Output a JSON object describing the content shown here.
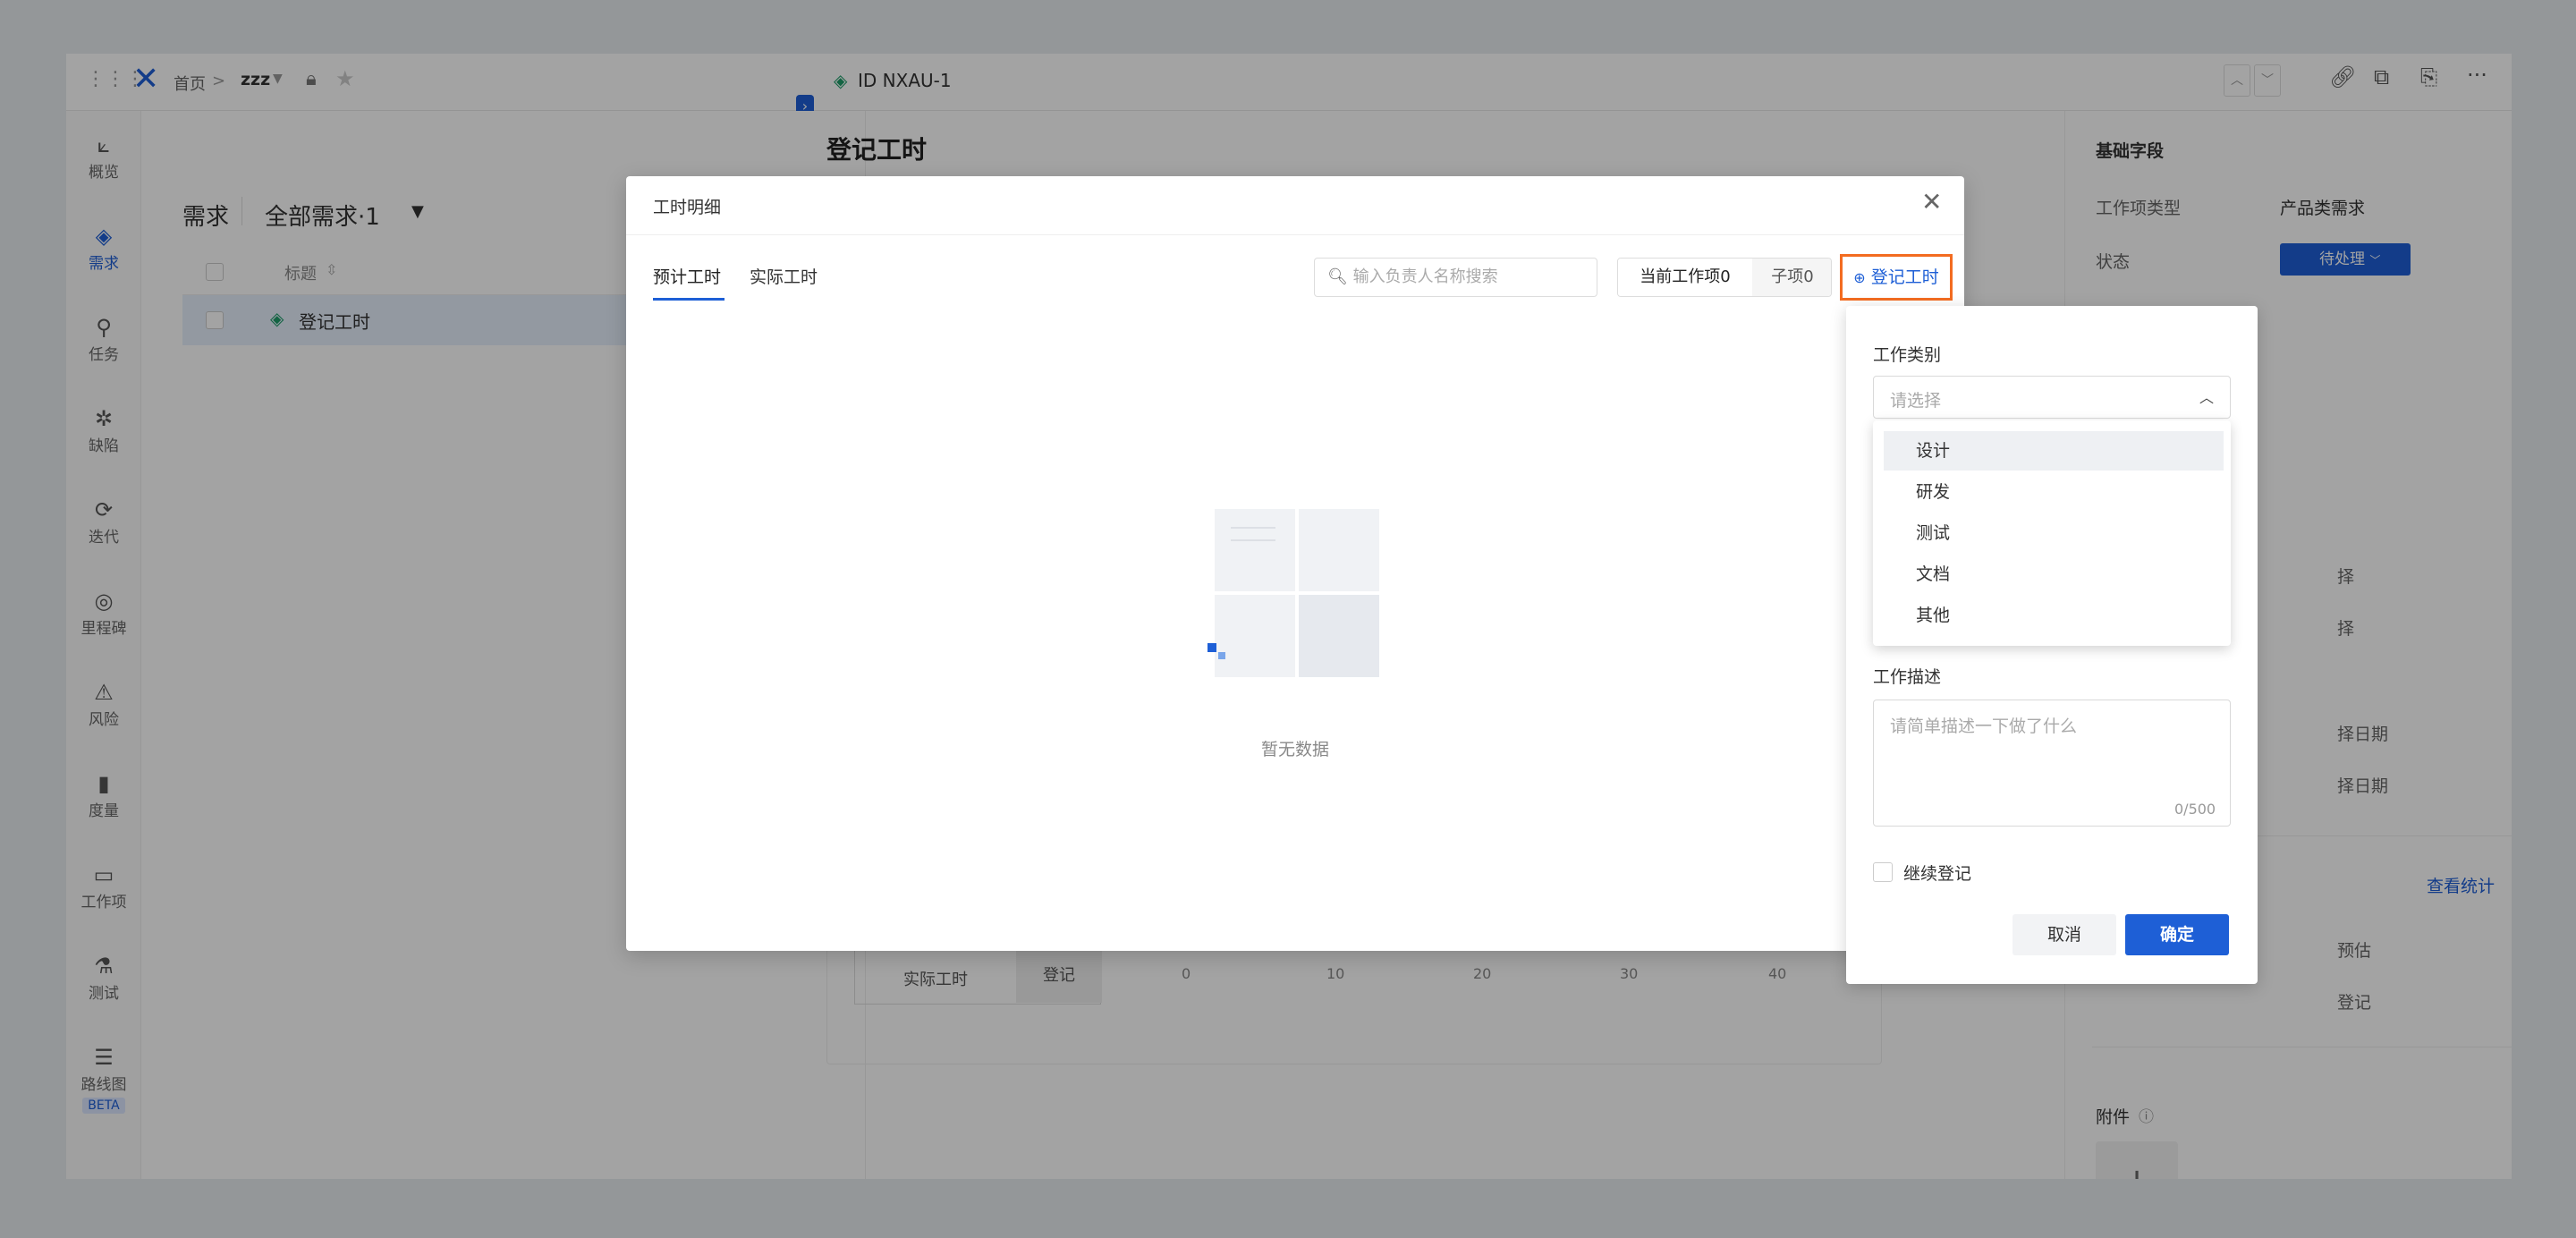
{
  "topbar": {
    "breadcrumb_home": "首页",
    "breadcrumb_sep": ">",
    "project": "zzz",
    "item_id": "ID NXAU-1"
  },
  "sidenav": [
    {
      "name": "overview",
      "icon": "chart-line-icon",
      "glyph": "⟀",
      "label": "概览"
    },
    {
      "name": "requirements",
      "icon": "layers-icon",
      "glyph": "◈",
      "label": "需求",
      "active": true
    },
    {
      "name": "tasks",
      "icon": "pin-icon",
      "glyph": "⚲",
      "label": "任务"
    },
    {
      "name": "defects",
      "icon": "bug-icon",
      "glyph": "✲",
      "label": "缺陷"
    },
    {
      "name": "iterations",
      "icon": "iteration-icon",
      "glyph": "⟳",
      "label": "迭代"
    },
    {
      "name": "milestones",
      "icon": "location-icon",
      "glyph": "◎",
      "label": "里程碑"
    },
    {
      "name": "risks",
      "icon": "warning-icon",
      "glyph": "⚠",
      "label": "风险"
    },
    {
      "name": "metrics",
      "icon": "bars-icon",
      "glyph": "▮",
      "label": "度量"
    },
    {
      "name": "workitems",
      "icon": "inbox-icon",
      "glyph": "▭",
      "label": "工作项"
    },
    {
      "name": "testing",
      "icon": "flask-icon",
      "glyph": "⚗",
      "label": "测试"
    },
    {
      "name": "roadmap",
      "icon": "roadmap-icon",
      "glyph": "☰",
      "label": "路线图",
      "badge": "BETA"
    }
  ],
  "list": {
    "title": "需求",
    "view": "全部需求·1",
    "column_title": "标题",
    "rows": [
      {
        "title": "登记工时"
      }
    ]
  },
  "detail": {
    "title": "登记工时",
    "panel_title": "基础字段",
    "fields": [
      {
        "label": "工作项类型",
        "value": "产品类需求"
      },
      {
        "label": "状态",
        "value": "待处理"
      }
    ],
    "partial_texts": [
      "择",
      "择",
      "择日期",
      "择日期",
      "预估",
      "登记"
    ],
    "stats_link": "查看统计",
    "attachments": "附件",
    "add": "+",
    "chart": {
      "row_label": "实际工时",
      "row_button": "登记",
      "ticks": [
        "0",
        "10",
        "20",
        "30",
        "40"
      ]
    }
  },
  "modal": {
    "title": "工时明细",
    "tabs": [
      "预计工时",
      "实际工时"
    ],
    "search_placeholder": "输入负责人名称搜索",
    "seg_current": "当前工作项0",
    "seg_child": "子项0",
    "log_button": "登记工时",
    "empty_text": "暂无数据"
  },
  "popover": {
    "category_label": "工作类别",
    "category_placeholder": "请选择",
    "options": [
      "设计",
      "研发",
      "测试",
      "文档",
      "其他"
    ],
    "desc_label": "工作描述",
    "desc_placeholder": "请简单描述一下做了什么",
    "counter": "0/500",
    "continue_label": "继续登记",
    "cancel": "取消",
    "confirm": "确定"
  },
  "colors": {
    "accent": "#1e5fd6",
    "highlight": "#f36c21",
    "status": "#1e5fd6"
  }
}
